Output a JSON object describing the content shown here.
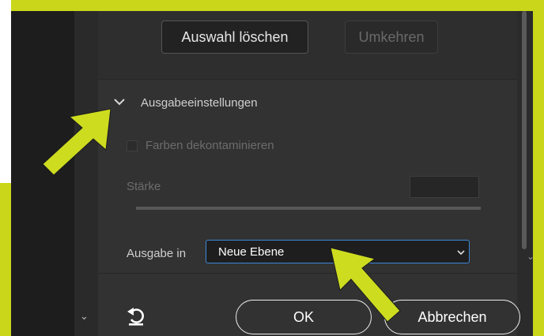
{
  "top_buttons": {
    "clear_selection": "Auswahl löschen",
    "invert": "Umkehren"
  },
  "output_settings": {
    "title": "Ausgabeeinstellungen",
    "decontaminate_label": "Farben dekontaminieren",
    "decontaminate_checked": false,
    "strength_label": "Stärke",
    "strength_value": "",
    "output_to_label": "Ausgabe in",
    "output_to_value": "Neue Ebene"
  },
  "footer": {
    "ok_label": "OK",
    "cancel_label": "Abbrechen"
  },
  "icons": {
    "disclosure": "chevron-down-icon",
    "reset": "reset-icon",
    "select_chevron": "chevron-down-icon"
  },
  "colors": {
    "highlight_frame": "#c9d61a",
    "annotation_arrow": "#cddc1f",
    "panel_bg": "#323232",
    "select_border": "#3d87d8"
  }
}
